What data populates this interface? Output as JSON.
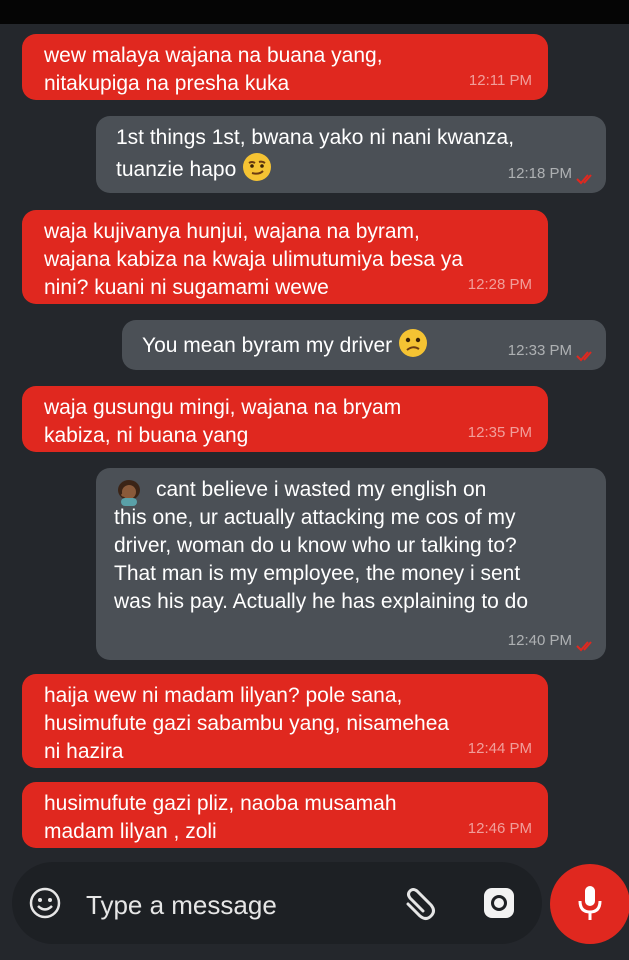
{
  "messages": [
    {
      "dir": "in",
      "text": "wew malaya wajana na buana yang,\nnitakupiga na presha kuka",
      "time": "12:11 PM"
    },
    {
      "dir": "out",
      "text": "1st things 1st, bwana yako ni nani kwanza,\ntuanzie hapo",
      "time": "12:18 PM",
      "emoji": "smirk-face-icon"
    },
    {
      "dir": "in",
      "text": "waja kujivanya hunjui, wajana na byram,\nwajana kabiza na kwaja ulimutumiya besa ya\nnini? kuani ni sugamami wewe",
      "time": "12:28 PM"
    },
    {
      "dir": "out",
      "text": "You mean byram my driver",
      "time": "12:33 PM",
      "emoji": "confused-face-icon"
    },
    {
      "dir": "in",
      "text": "waja gusungu mingi, wajana na bryam\nkabiza, ni buana yang",
      "time": "12:35 PM"
    },
    {
      "dir": "out",
      "text": "cant believe i wasted my english on\nthis one, ur actually attacking me cos of my\ndriver, woman do u know who ur talking to?\nThat man is my employee, the money i sent\nwas his pay. Actually he has explaining to do",
      "time": "12:40 PM",
      "emoji": "facepalm-woman-icon"
    },
    {
      "dir": "in",
      "text": "haija wew ni madam lilyan? pole sana,\nhusimufute gazi sabambu yang, nisamehea\nni hazira",
      "time": "12:44 PM"
    },
    {
      "dir": "in",
      "text": "husimufute gazi pliz, naoba musamah\nmadam lilyan , zoli",
      "time": "12:46 PM"
    }
  ],
  "composer": {
    "placeholder": "Type a message",
    "emoji_button_icon": "smiley-icon",
    "attach_icon": "paperclip-icon",
    "camera_icon": "camera-icon",
    "mic_icon": "microphone-icon"
  },
  "colors": {
    "incoming": "#e0281f",
    "outgoing": "#4b5056",
    "background": "#24272c",
    "read_ticks": "#e0281f"
  }
}
